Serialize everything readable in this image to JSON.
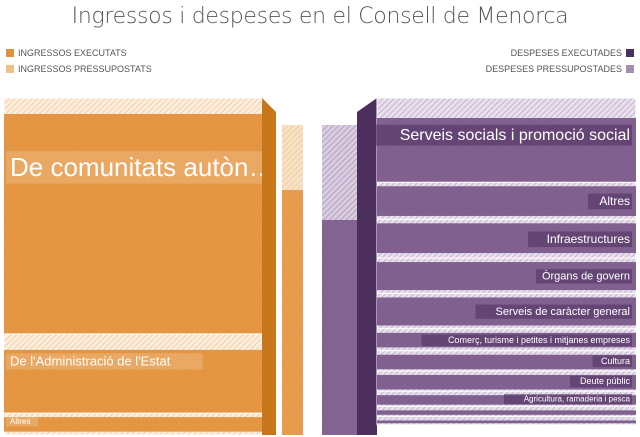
{
  "title": "Ingressos i despeses en el Consell de Menorca",
  "legend": {
    "income_executed": "INGRESSOS EXECUTATS",
    "income_budgeted": "INGRESSOS PRESSUPOSTATS",
    "spend_executed": "DESPESES EXECUTADES",
    "spend_budgeted": "DESPESES PRESSUPOSTADES"
  },
  "colors": {
    "income_fill": "#e3903a",
    "income_dark": "#c8761b",
    "income_hatch_bg": "#fbeedd",
    "spend_fill": "#7a5a8a",
    "spend_dark": "#4d2f5e",
    "spend_hatch_bg": "#e8e0ec"
  },
  "chart_data": {
    "type": "stacked-block",
    "income": {
      "categories": [
        {
          "label": "De comunitats autòn…",
          "budget": 0.7,
          "executed": 0.7
        },
        {
          "label": "De l'Administració de l'Estat",
          "budget": 0.235,
          "executed": 0.235
        },
        {
          "label": "Altres",
          "budget": 0.065,
          "executed": 0.055
        }
      ]
    },
    "spend": {
      "categories": [
        {
          "label": "Serveis socials i promoció social",
          "budget": 0.25,
          "executed": 0.25
        },
        {
          "label": "Altres",
          "budget": 0.11,
          "executed": 0.1
        },
        {
          "label": "Infraestructures",
          "budget": 0.115,
          "executed": 0.1
        },
        {
          "label": "Òrgans de govern",
          "budget": 0.105,
          "executed": 0.095
        },
        {
          "label": "Serveis de caràcter general",
          "budget": 0.105,
          "executed": 0.095
        },
        {
          "label": "Comerç, turisme i petites i mitjanes empreses",
          "budget": 0.065,
          "executed": 0.055
        },
        {
          "label": "Cultura",
          "budget": 0.06,
          "executed": 0.055
        },
        {
          "label": "Deute públic",
          "budget": 0.06,
          "executed": 0.055
        },
        {
          "label": "Agricultura, ramaderia i pesca",
          "budget": 0.045,
          "executed": 0.04
        },
        {
          "label": "",
          "budget": 0.03,
          "executed": 0.025
        },
        {
          "label": "",
          "budget": 0.025,
          "executed": 0.02
        }
      ]
    }
  }
}
